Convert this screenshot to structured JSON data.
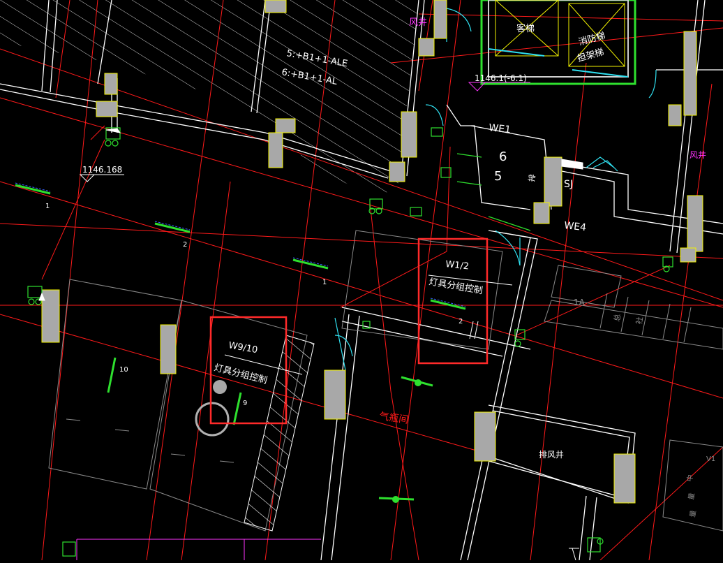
{
  "colors": {
    "background": "#000000",
    "red": "#ff1a1a",
    "wall": "#ffffff",
    "column": "#a8a8a8",
    "yellow": "#f2f200",
    "green": "#2ee02e",
    "cyan": "#30e0f0",
    "magenta": "#ff33ff",
    "highlight": "#ff2a2a",
    "gray": "#8a8a8a"
  },
  "labels": {
    "elevator_passenger": "客梯",
    "elevator_fire": "消防梯",
    "elevator_fire2": "担架梯",
    "air_shaft_top": "风井",
    "air_shaft_right": "风井",
    "panel_1": "5:+B1+1-ALE",
    "panel_2": "6:+B1+1-AL",
    "elevation_top": "1146.1(-6.1)",
    "elevation_left": "1146.168",
    "we1": "WE1",
    "we4": "WE4",
    "num_6": "6",
    "num_5": "5",
    "sj": "SJ",
    "vertical_tag": "排",
    "box1_title": "W1/2",
    "box1_text": "灯具分组控制",
    "box2_title": "W9/10",
    "box2_text": "灯具分组控制",
    "gas_room": "气瓶间",
    "exhaust_shaft": "排风井",
    "light_1": "1",
    "light_2": "2",
    "light_3": "1",
    "light_4": "2",
    "light_10": "10",
    "light_9": "9",
    "room_1a": "1A",
    "room_zong": "总",
    "room_she": "社",
    "right_text_1": "中",
    "right_text_2": "量",
    "right_text_3": "量",
    "right_text_4": "V1"
  }
}
